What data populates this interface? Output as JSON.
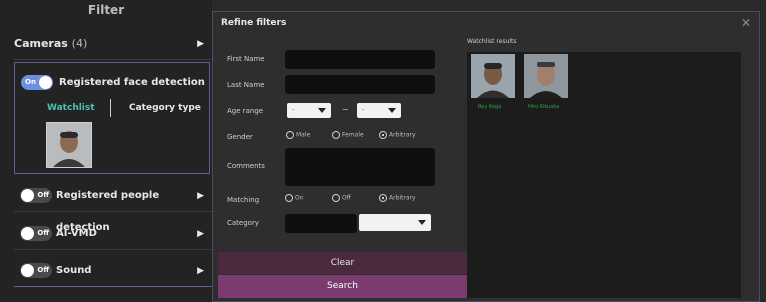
{
  "sidebar": {
    "title": "Filter",
    "cameras": {
      "label": "Cameras",
      "count": "(4)"
    },
    "face_detection": {
      "toggle": "On",
      "label": "Registered face detection",
      "tab_watchlist": "Watchlist",
      "tab_category": "Category type"
    },
    "people_detection": {
      "toggle": "Off",
      "label": "Registered people detection"
    },
    "ai_vmd": {
      "toggle": "Off",
      "label": "AI-VMD"
    },
    "sound": {
      "toggle": "Off",
      "label": "Sound"
    }
  },
  "dialog": {
    "title": "Refine filters",
    "first_name": {
      "label": "First Name",
      "value": ""
    },
    "last_name": {
      "label": "Last Name",
      "value": ""
    },
    "age_range": {
      "label": "Age range",
      "from": "-",
      "separator": "~",
      "to": "-"
    },
    "gender": {
      "label": "Gender",
      "options": [
        "Male",
        "Female",
        "Arbitrary"
      ],
      "selected": "Arbitrary"
    },
    "comments": {
      "label": "Comments",
      "value": ""
    },
    "matching": {
      "label": "Matching",
      "options": [
        "On",
        "Off",
        "Arbitrary"
      ],
      "selected": "Arbitrary"
    },
    "category": {
      "label": "Category",
      "value": "",
      "select_value": ""
    },
    "clear_label": "Clear",
    "search_label": "Search",
    "results_title": "Watchlist results",
    "results": [
      {
        "name": "Rey Koga"
      },
      {
        "name": "Hiro Kikuoka"
      }
    ]
  },
  "colors": {
    "accent": "#7a3c6e",
    "toggle_on": "#6c8fe0",
    "result_name": "#3aa04a"
  }
}
